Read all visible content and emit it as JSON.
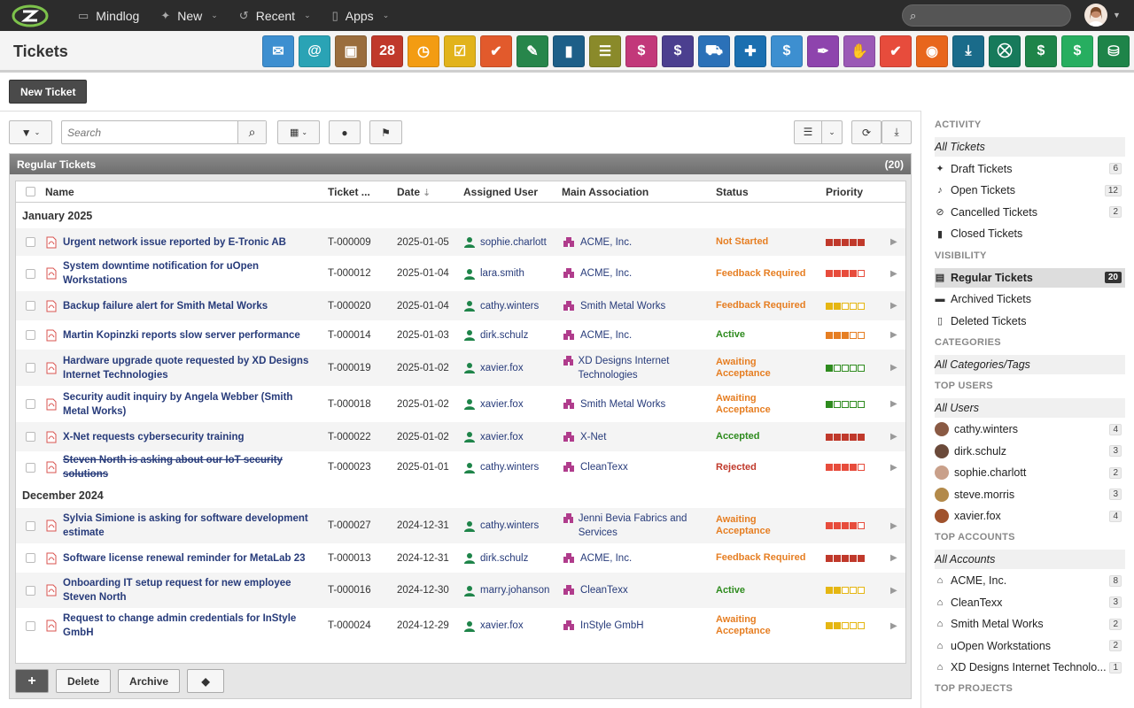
{
  "topbar": {
    "nav": [
      {
        "label": "Mindlog",
        "icon": "monitor-icon"
      },
      {
        "label": "New",
        "icon": "sparkle-icon"
      },
      {
        "label": "Recent",
        "icon": "history-icon"
      },
      {
        "label": "Apps",
        "icon": "tablet-icon"
      }
    ]
  },
  "page": {
    "title": "Tickets",
    "new_button": "New Ticket"
  },
  "apps": [
    {
      "name": "mail-app-icon",
      "color": "#3d8fd0",
      "glyph": "✉"
    },
    {
      "name": "address-app-icon",
      "color": "#2aa3b5",
      "glyph": "@"
    },
    {
      "name": "contacts-app-icon",
      "color": "#9a6d3d",
      "glyph": "▣"
    },
    {
      "name": "calendar-app-icon",
      "color": "#c0392b",
      "glyph": "28"
    },
    {
      "name": "timer-app-icon",
      "color": "#f39c12",
      "glyph": "◷"
    },
    {
      "name": "tasks-app-icon",
      "color": "#e2b31b",
      "glyph": "☑"
    },
    {
      "name": "projects-app-icon",
      "color": "#e25a2c",
      "glyph": "✔"
    },
    {
      "name": "notes-app-icon",
      "color": "#27864b",
      "glyph": "✎"
    },
    {
      "name": "bookmark-app-icon",
      "color": "#1d5f88",
      "glyph": "▮"
    },
    {
      "name": "documents-app-icon",
      "color": "#8a8a2a",
      "glyph": "☰"
    },
    {
      "name": "sales-app-icon",
      "color": "#c2387a",
      "glyph": "$"
    },
    {
      "name": "billing-app-icon",
      "color": "#4b3f8f",
      "glyph": "$"
    },
    {
      "name": "delivery-app-icon",
      "color": "#2b71b8",
      "glyph": "⛟"
    },
    {
      "name": "support-app-icon",
      "color": "#1b6fb0",
      "glyph": "✚"
    },
    {
      "name": "money-app-icon",
      "color": "#3d8fd0",
      "glyph": "$"
    },
    {
      "name": "contracts-app-icon",
      "color": "#8e44ad",
      "glyph": "✒"
    },
    {
      "name": "deals-app-icon",
      "color": "#9b59b6",
      "glyph": "✋"
    },
    {
      "name": "tickets-app-icon",
      "color": "#e74c3c",
      "glyph": "✔"
    },
    {
      "name": "broadcast-app-icon",
      "color": "#e8661c",
      "glyph": "◉"
    },
    {
      "name": "download-app-icon",
      "color": "#1a6b8a",
      "glyph": "⤓"
    },
    {
      "name": "shop-app-icon",
      "color": "#177a5b",
      "glyph": "⛒"
    },
    {
      "name": "finance-app-icon",
      "color": "#1e8449",
      "glyph": "$"
    },
    {
      "name": "tag-app-icon",
      "color": "#27ae60",
      "glyph": "$"
    },
    {
      "name": "database-app-icon",
      "color": "#1e8449",
      "glyph": "⛁"
    }
  ],
  "toolbar": {
    "search_placeholder": "Search"
  },
  "panel": {
    "title": "Regular Tickets",
    "count": "(20)"
  },
  "columns": {
    "name": "Name",
    "ticket": "Ticket ...",
    "date": "Date",
    "user": "Assigned User",
    "assoc": "Main Association",
    "status": "Status",
    "priority": "Priority"
  },
  "groups": [
    {
      "label": "January 2025",
      "rows": [
        {
          "name": "Urgent network issue reported by E-Tronic AB",
          "id": "T-000009",
          "date": "2025-01-05",
          "user": "sophie.charlott",
          "assoc": "ACME, Inc.",
          "status": "Not Started",
          "status_color": "#e67e22",
          "prio": 5,
          "prio_color": "#c0392b"
        },
        {
          "name": "System downtime notification for uOpen Workstations",
          "id": "T-000012",
          "date": "2025-01-04",
          "user": "lara.smith",
          "assoc": "ACME, Inc.",
          "status": "Feedback Required",
          "status_color": "#e67e22",
          "prio": 4,
          "prio_color": "#e74c3c"
        },
        {
          "name": "Backup failure alert for Smith Metal Works",
          "id": "T-000020",
          "date": "2025-01-04",
          "user": "cathy.winters",
          "assoc": "Smith Metal Works",
          "status": "Feedback Required",
          "status_color": "#e67e22",
          "prio": 2,
          "prio_color": "#e5b612"
        },
        {
          "name": "Martin Kopinzki reports slow server performance",
          "id": "T-000014",
          "date": "2025-01-03",
          "user": "dirk.schulz",
          "assoc": "ACME, Inc.",
          "status": "Active",
          "status_color": "#2e8b1e",
          "prio": 3,
          "prio_color": "#e67e22"
        },
        {
          "name": "Hardware upgrade quote requested by XD Designs Internet Technologies",
          "id": "T-000019",
          "date": "2025-01-02",
          "user": "xavier.fox",
          "assoc": "XD Designs Internet Technologies",
          "status": "Awaiting Acceptance",
          "status_color": "#e67e22",
          "prio": 1,
          "prio_color": "#2e8b1e"
        },
        {
          "name": "Security audit inquiry by Angela Webber (Smith Metal Works)",
          "id": "T-000018",
          "date": "2025-01-02",
          "user": "xavier.fox",
          "assoc": "Smith Metal Works",
          "status": "Awaiting Acceptance",
          "status_color": "#e67e22",
          "prio": 1,
          "prio_color": "#2e8b1e"
        },
        {
          "name": "X-Net requests cybersecurity training",
          "id": "T-000022",
          "date": "2025-01-02",
          "user": "xavier.fox",
          "assoc": "X-Net",
          "status": "Accepted",
          "status_color": "#2e8b1e",
          "prio": 5,
          "prio_color": "#c0392b"
        },
        {
          "name": "Steven North is asking about our IoT security solutions",
          "id": "T-000023",
          "date": "2025-01-01",
          "user": "cathy.winters",
          "assoc": "CleanTexx",
          "status": "Rejected",
          "status_color": "#c0392b",
          "prio": 4,
          "prio_color": "#e74c3c",
          "strike": true
        }
      ]
    },
    {
      "label": "December 2024",
      "rows": [
        {
          "name": "Sylvia Simione is asking for software development estimate",
          "id": "T-000027",
          "date": "2024-12-31",
          "user": "cathy.winters",
          "assoc": "Jenni Bevia Fabrics and Services",
          "status": "Awaiting Acceptance",
          "status_color": "#e67e22",
          "prio": 4,
          "prio_color": "#e74c3c"
        },
        {
          "name": "Software license renewal reminder for MetaLab 23",
          "id": "T-000013",
          "date": "2024-12-31",
          "user": "dirk.schulz",
          "assoc": "ACME, Inc.",
          "status": "Feedback Required",
          "status_color": "#e67e22",
          "prio": 5,
          "prio_color": "#c0392b"
        },
        {
          "name": "Onboarding IT setup request for new employee Steven North",
          "id": "T-000016",
          "date": "2024-12-30",
          "user": "marry.johanson",
          "assoc": "CleanTexx",
          "status": "Active",
          "status_color": "#2e8b1e",
          "prio": 2,
          "prio_color": "#e5b612"
        },
        {
          "name": "Request to change admin credentials for InStyle GmbH",
          "id": "T-000024",
          "date": "2024-12-29",
          "user": "xavier.fox",
          "assoc": "InStyle GmbH",
          "status": "Awaiting Acceptance",
          "status_color": "#e67e22",
          "prio": 2,
          "prio_color": "#e5b612"
        }
      ]
    }
  ],
  "bottom": {
    "add": "+",
    "delete": "Delete",
    "archive": "Archive"
  },
  "sidebar": {
    "activity_head": "ACTIVITY",
    "all_tickets": "All Tickets",
    "activity": [
      {
        "label": "Draft Tickets",
        "count": "6",
        "icon": "sparkle-icon",
        "glyph": "✦"
      },
      {
        "label": "Open Tickets",
        "count": "12",
        "icon": "bell-icon",
        "glyph": "♪"
      },
      {
        "label": "Cancelled Tickets",
        "count": "2",
        "icon": "ban-icon",
        "glyph": "⊘"
      },
      {
        "label": "Closed Tickets",
        "count": "",
        "icon": "book-icon",
        "glyph": "▮"
      }
    ],
    "visibility_head": "VISIBILITY",
    "visibility": [
      {
        "label": "Regular Tickets",
        "count": "20",
        "icon": "inbox-icon",
        "glyph": "▤",
        "selected": true
      },
      {
        "label": "Archived Tickets",
        "count": "",
        "icon": "archive-icon",
        "glyph": "▬"
      },
      {
        "label": "Deleted Tickets",
        "count": "",
        "icon": "trash-icon",
        "glyph": "▯"
      }
    ],
    "categories_head": "CATEGORIES",
    "all_categories": "All Categories/Tags",
    "users_head": "TOP USERS",
    "all_users": "All Users",
    "users": [
      {
        "label": "cathy.winters",
        "count": "4",
        "color": "#8a5a44"
      },
      {
        "label": "dirk.schulz",
        "count": "3",
        "color": "#6b4a3a"
      },
      {
        "label": "sophie.charlott",
        "count": "2",
        "color": "#c9a08a"
      },
      {
        "label": "steve.morris",
        "count": "3",
        "color": "#b38a4a"
      },
      {
        "label": "xavier.fox",
        "count": "4",
        "color": "#a0522d"
      }
    ],
    "accounts_head": "TOP ACCOUNTS",
    "all_accounts": "All Accounts",
    "accounts": [
      {
        "label": "ACME, Inc.",
        "count": "8"
      },
      {
        "label": "CleanTexx",
        "count": "3"
      },
      {
        "label": "Smith Metal Works",
        "count": "2"
      },
      {
        "label": "uOpen Workstations",
        "count": "2"
      },
      {
        "label": "XD Designs Internet Technolo...",
        "count": "1"
      }
    ],
    "projects_head": "TOP PROJECTS"
  }
}
